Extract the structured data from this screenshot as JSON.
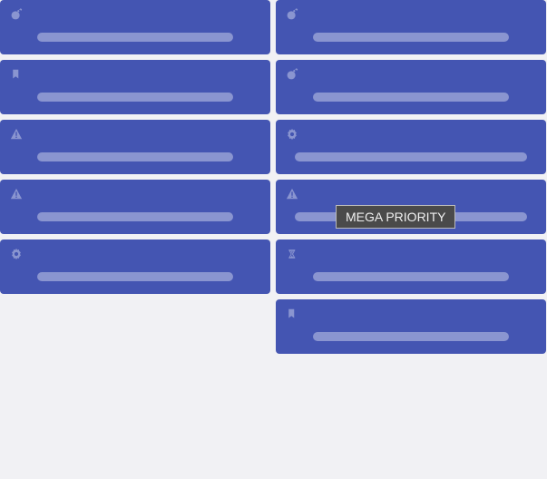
{
  "tooltip": {
    "label": "MEGA PRIORITY"
  },
  "colors": {
    "card_bg": "#4455b2",
    "card_accent": "#8a95d0",
    "page_bg": "#f1f1f4",
    "tooltip_bg": "#4a4a4a",
    "tooltip_text": "#f0f0f0"
  },
  "columns": [
    {
      "cards": [
        {
          "icon": "bomb",
          "bar": "normal",
          "tooltip": false
        },
        {
          "icon": "bookmark",
          "bar": "normal",
          "tooltip": false
        },
        {
          "icon": "warning",
          "bar": "normal",
          "tooltip": false
        },
        {
          "icon": "warning",
          "bar": "normal",
          "tooltip": false
        },
        {
          "icon": "gear",
          "bar": "normal",
          "tooltip": false
        }
      ]
    },
    {
      "cards": [
        {
          "icon": "bomb",
          "bar": "normal",
          "tooltip": false
        },
        {
          "icon": "bomb",
          "bar": "normal",
          "tooltip": false
        },
        {
          "icon": "gear",
          "bar": "wide",
          "tooltip": false
        },
        {
          "icon": "warning",
          "bar": "wide",
          "tooltip": true
        },
        {
          "icon": "hourglass",
          "bar": "normal",
          "tooltip": false
        },
        {
          "icon": "bookmark",
          "bar": "normal",
          "tooltip": false
        }
      ]
    }
  ]
}
